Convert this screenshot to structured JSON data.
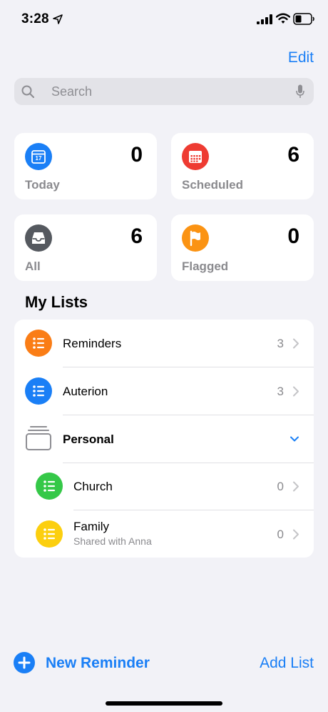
{
  "status": {
    "time": "3:28"
  },
  "header": {
    "edit_label": "Edit"
  },
  "search": {
    "placeholder": "Search"
  },
  "smart_lists": [
    {
      "label": "Today",
      "count": "0",
      "day": "17",
      "color": "#1a7ff6",
      "icon": "calendar-icon"
    },
    {
      "label": "Scheduled",
      "count": "6",
      "color": "#ee3b32",
      "icon": "calendar-grid-icon"
    },
    {
      "label": "All",
      "count": "6",
      "color": "#55595f",
      "icon": "tray-icon"
    },
    {
      "label": "Flagged",
      "count": "0",
      "color": "#fb9313",
      "icon": "flag-icon"
    }
  ],
  "my_lists": {
    "title": "My Lists",
    "items": [
      {
        "name": "Reminders",
        "count": "3",
        "color": "#fa7d16",
        "icon": "list-bullet-icon"
      },
      {
        "name": "Auterion",
        "count": "3",
        "color": "#1a7ff6",
        "icon": "list-bullet-icon"
      },
      {
        "name": "Personal",
        "icon": "stack-folder-icon"
      },
      {
        "name": "Church",
        "count": "0",
        "color": "#35c848",
        "icon": "list-bullet-icon"
      },
      {
        "name": "Family",
        "subtitle": "Shared with Anna",
        "count": "0",
        "color": "#fccf0f",
        "icon": "list-bullet-icon"
      }
    ]
  },
  "footer": {
    "new_reminder_label": "New Reminder",
    "add_list_label": "Add List"
  }
}
